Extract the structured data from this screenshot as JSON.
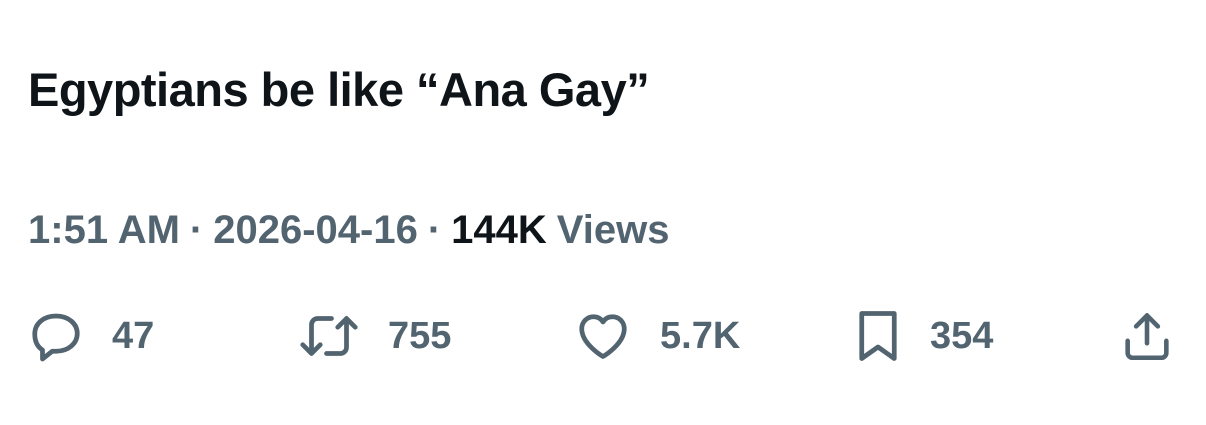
{
  "tweet": {
    "text": "Egyptians be like “Ana Gay”"
  },
  "meta": {
    "time": "1:51 AM",
    "separator": "·",
    "date": "2026-04-16",
    "views_count": "144K",
    "views_label": "Views"
  },
  "actions": {
    "reply": {
      "icon": "reply-icon",
      "count": "47"
    },
    "retweet": {
      "icon": "retweet-icon",
      "count": "755"
    },
    "like": {
      "icon": "heart-icon",
      "count": "5.7K"
    },
    "bookmark": {
      "icon": "bookmark-icon",
      "count": "354"
    },
    "share": {
      "icon": "share-icon"
    }
  },
  "colors": {
    "text_primary": "#0f1419",
    "text_secondary": "#536471",
    "background": "#ffffff"
  }
}
